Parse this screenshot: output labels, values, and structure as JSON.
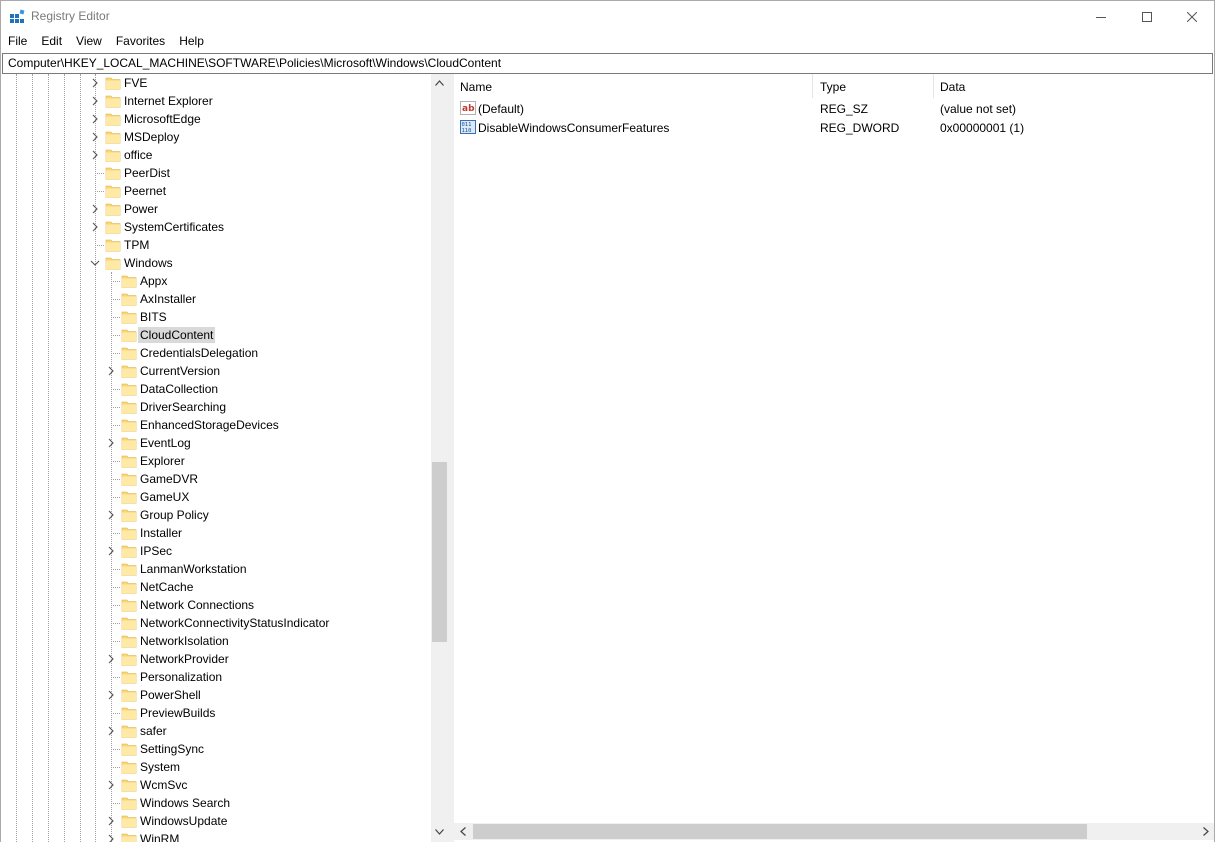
{
  "window": {
    "title": "Registry Editor"
  },
  "menu": [
    "File",
    "Edit",
    "View",
    "Favorites",
    "Help"
  ],
  "address": "Computer\\HKEY_LOCAL_MACHINE\\SOFTWARE\\Policies\\Microsoft\\Windows\\CloudContent",
  "tree": {
    "items": [
      {
        "label": "FVE",
        "level": 0,
        "expandable": true
      },
      {
        "label": "Internet Explorer",
        "level": 0,
        "expandable": true
      },
      {
        "label": "MicrosoftEdge",
        "level": 0,
        "expandable": true
      },
      {
        "label": "MSDeploy",
        "level": 0,
        "expandable": true
      },
      {
        "label": "office",
        "level": 0,
        "expandable": true
      },
      {
        "label": "PeerDist",
        "level": 0,
        "expandable": false
      },
      {
        "label": "Peernet",
        "level": 0,
        "expandable": false
      },
      {
        "label": "Power",
        "level": 0,
        "expandable": true
      },
      {
        "label": "SystemCertificates",
        "level": 0,
        "expandable": true
      },
      {
        "label": "TPM",
        "level": 0,
        "expandable": false
      },
      {
        "label": "Windows",
        "level": 0,
        "expandable": true,
        "expanded": true
      },
      {
        "label": "Appx",
        "level": 1,
        "expandable": false
      },
      {
        "label": "AxInstaller",
        "level": 1,
        "expandable": false
      },
      {
        "label": "BITS",
        "level": 1,
        "expandable": false
      },
      {
        "label": "CloudContent",
        "level": 1,
        "expandable": false,
        "selected": true
      },
      {
        "label": "CredentialsDelegation",
        "level": 1,
        "expandable": false
      },
      {
        "label": "CurrentVersion",
        "level": 1,
        "expandable": true
      },
      {
        "label": "DataCollection",
        "level": 1,
        "expandable": false
      },
      {
        "label": "DriverSearching",
        "level": 1,
        "expandable": false
      },
      {
        "label": "EnhancedStorageDevices",
        "level": 1,
        "expandable": false
      },
      {
        "label": "EventLog",
        "level": 1,
        "expandable": true
      },
      {
        "label": "Explorer",
        "level": 1,
        "expandable": false
      },
      {
        "label": "GameDVR",
        "level": 1,
        "expandable": false
      },
      {
        "label": "GameUX",
        "level": 1,
        "expandable": false
      },
      {
        "label": "Group Policy",
        "level": 1,
        "expandable": true
      },
      {
        "label": "Installer",
        "level": 1,
        "expandable": false
      },
      {
        "label": "IPSec",
        "level": 1,
        "expandable": true
      },
      {
        "label": "LanmanWorkstation",
        "level": 1,
        "expandable": false
      },
      {
        "label": "NetCache",
        "level": 1,
        "expandable": false
      },
      {
        "label": "Network Connections",
        "level": 1,
        "expandable": false
      },
      {
        "label": "NetworkConnectivityStatusIndicator",
        "level": 1,
        "expandable": false
      },
      {
        "label": "NetworkIsolation",
        "level": 1,
        "expandable": false
      },
      {
        "label": "NetworkProvider",
        "level": 1,
        "expandable": true
      },
      {
        "label": "Personalization",
        "level": 1,
        "expandable": false
      },
      {
        "label": "PowerShell",
        "level": 1,
        "expandable": true
      },
      {
        "label": "PreviewBuilds",
        "level": 1,
        "expandable": false
      },
      {
        "label": "safer",
        "level": 1,
        "expandable": true
      },
      {
        "label": "SettingSync",
        "level": 1,
        "expandable": false
      },
      {
        "label": "System",
        "level": 1,
        "expandable": false
      },
      {
        "label": "WcmSvc",
        "level": 1,
        "expandable": true
      },
      {
        "label": "Windows Search",
        "level": 1,
        "expandable": false
      },
      {
        "label": "WindowsUpdate",
        "level": 1,
        "expandable": true
      },
      {
        "label": "WinRM",
        "level": 1,
        "expandable": true
      }
    ]
  },
  "list": {
    "columns": [
      "Name",
      "Type",
      "Data"
    ],
    "rows": [
      {
        "name": "(Default)",
        "type": "REG_SZ",
        "data": "(value not set)",
        "icon": "string-value-icon"
      },
      {
        "name": "DisableWindowsConsumerFeatures",
        "type": "REG_DWORD",
        "data": "0x00000001 (1)",
        "icon": "dword-value-icon"
      }
    ]
  }
}
